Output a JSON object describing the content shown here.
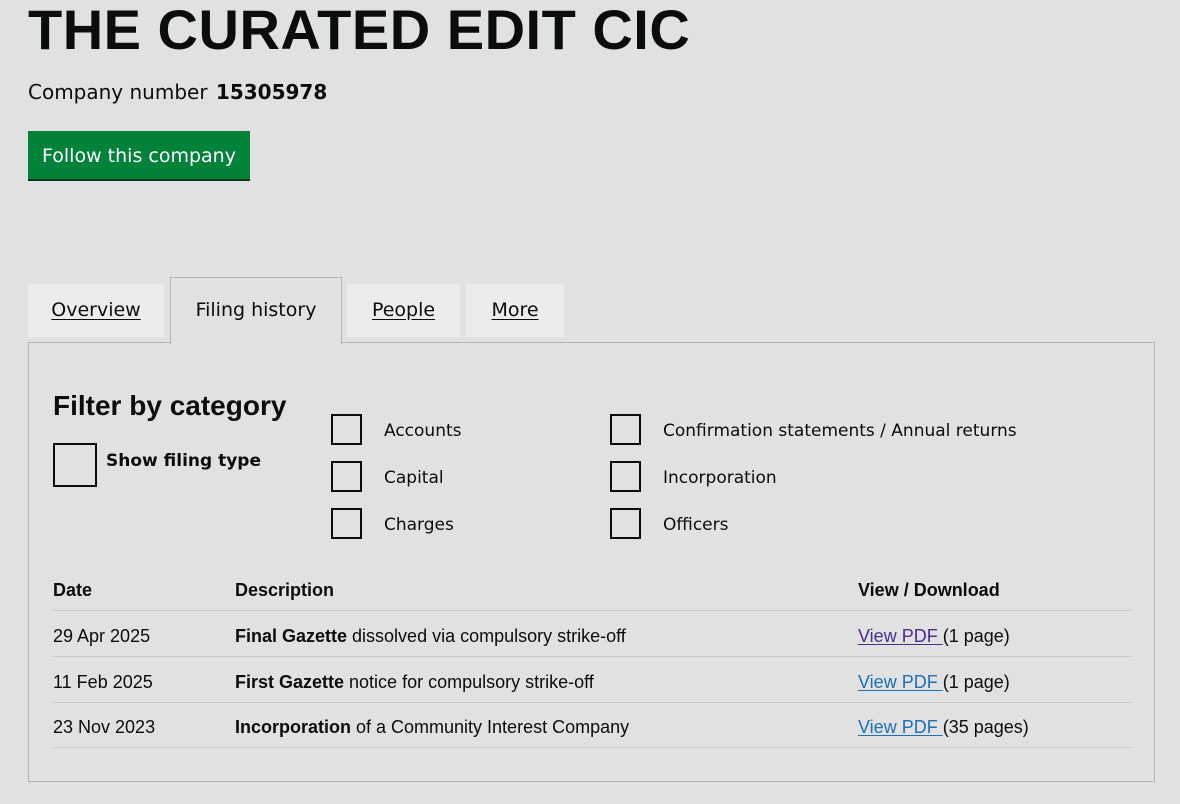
{
  "company": {
    "name": "THE CURATED EDIT CIC",
    "number_label": "Company number",
    "number": "15305978",
    "follow_label": "Follow this company"
  },
  "tabs": [
    {
      "label": "Overview",
      "active": false
    },
    {
      "label": "Filing history",
      "active": true
    },
    {
      "label": "People",
      "active": false
    },
    {
      "label": "More",
      "active": false
    }
  ],
  "filter": {
    "heading": "Filter by category",
    "show_filing_type": "Show filing type",
    "categories": [
      "Accounts",
      "Capital",
      "Charges",
      "Confirmation statements / Annual returns",
      "Incorporation",
      "Officers"
    ]
  },
  "table": {
    "headers": [
      "Date",
      "Description",
      "View / Download"
    ],
    "rows": [
      {
        "date": "29 Apr 2025",
        "desc_bold": "Final Gazette",
        "desc_rest": " dissolved via compulsory strike-off",
        "link": "View PDF ",
        "pages": "(1 page)"
      },
      {
        "date": "11 Feb 2025",
        "desc_bold": "First Gazette",
        "desc_rest": " notice for compulsory strike-off",
        "link": "View PDF ",
        "pages": "(1 page)"
      },
      {
        "date": "23 Nov 2023",
        "desc_bold": "Incorporation",
        "desc_rest": " of a Community Interest Company",
        "link": "View PDF ",
        "pages": "(35 pages)"
      }
    ]
  },
  "colors": {
    "follow_button": "#00823b",
    "link": "#1d70b8",
    "visited_link": "#4c2c92",
    "background": "#e1e1e1"
  }
}
